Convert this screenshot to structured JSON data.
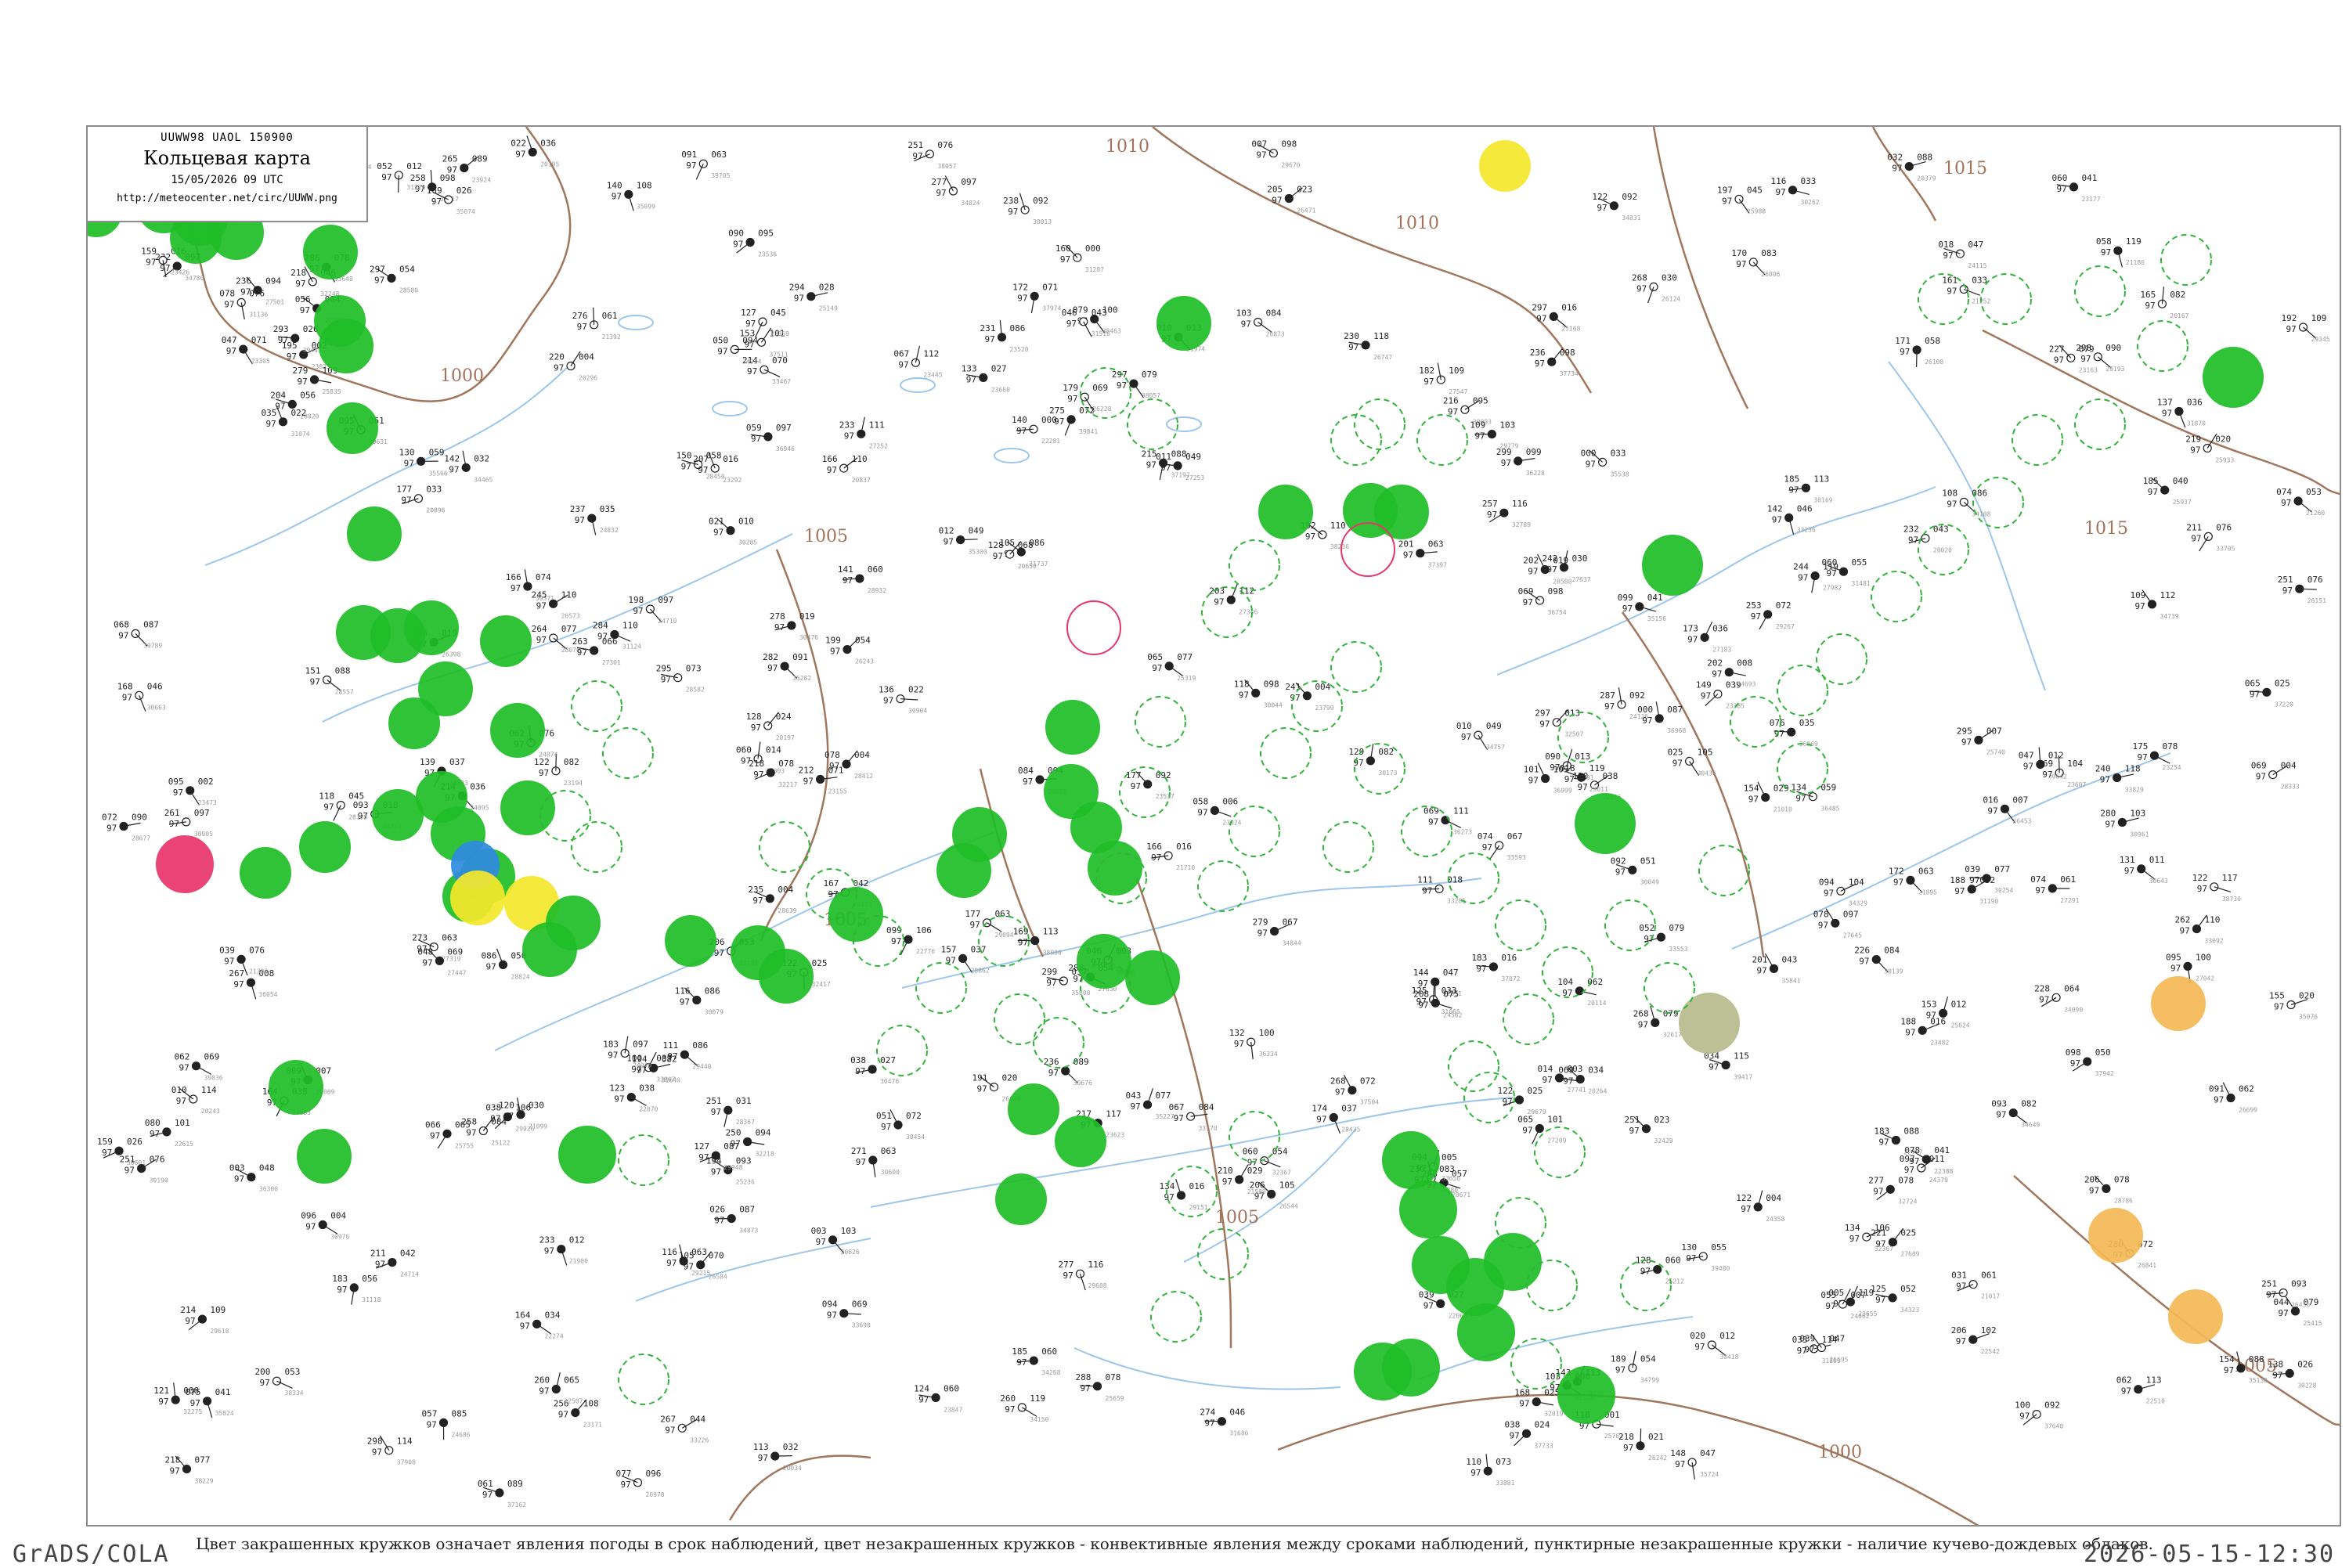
{
  "title_box": {
    "line1": "UUWW98 UAOL 150900",
    "line2": "Кольцевая карта",
    "line3": "15/05/2026 09 UTC",
    "line4": "http://meteocenter.net/circ/UUWW.png"
  },
  "isobar_labels": [
    "1000",
    "1005",
    "1010",
    "1015"
  ],
  "legend_note": "Цвет закрашенных кружков означает явления погоды в срок наблюдений, цвет незакрашенных кружков - конвективные явления между сроками наблюдений, пунктирные незакрашенные кружки - наличие кучево-дождевых облаков.",
  "footer": {
    "left": "GrADS/COLA",
    "right": "2026-05-15-12:30"
  },
  "colors": {
    "isobar": "#a0765d",
    "river": "#9cc6ea",
    "rain": "#1fbe27",
    "drizzle": "#7fe3a0",
    "snow": "#2f8be0",
    "fog": "#f5e92c",
    "haze": "#f6b955",
    "thunder": "#e8356a",
    "dust": "#b8bb8c",
    "cb_dashed": "#32b43a"
  }
}
